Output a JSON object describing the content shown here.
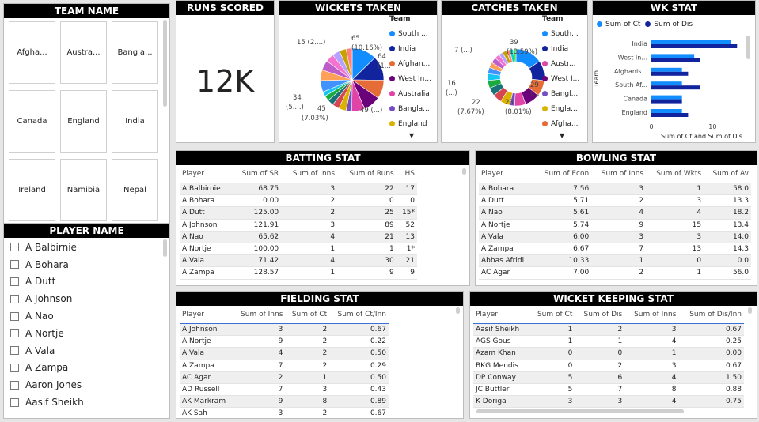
{
  "team_name": {
    "title": "TEAM NAME",
    "tiles": [
      "Afgha...",
      "Austra...",
      "Bangla...",
      "Canada",
      "England",
      "India",
      "Ireland",
      "Namibia",
      "Nepal"
    ]
  },
  "player_name": {
    "title": "PLAYER NAME",
    "players": [
      "A Balbirnie",
      "A Bohara",
      "A Dutt",
      "A Johnson",
      "A Nao",
      "A Nortje",
      "A Vala",
      "A Zampa",
      "Aaron Jones",
      "Aasif Sheikh"
    ]
  },
  "runs_scored": {
    "title": "RUNS SCORED",
    "value": "12K"
  },
  "wickets_taken": {
    "title": "WICKETS TAKEN",
    "legend_title": "Team",
    "legend": [
      {
        "label": "South ...",
        "color": "#118DFF"
      },
      {
        "label": "India",
        "color": "#12239E"
      },
      {
        "label": "Afghan...",
        "color": "#E66C37"
      },
      {
        "label": "West In...",
        "color": "#6B007B"
      },
      {
        "label": "Australia",
        "color": "#E044A7"
      },
      {
        "label": "Bangla...",
        "color": "#744EC2"
      },
      {
        "label": "England",
        "color": "#D9B300"
      }
    ],
    "labels": {
      "a": "15 (2....)",
      "b1": "65",
      "b2": "(10.16%)",
      "c1": "64",
      "c2": "(1...",
      "d1": "34",
      "d2": "(5....)",
      "e1": "45",
      "e2": "(7.03%)",
      "f": "49 (...)"
    }
  },
  "catches_taken": {
    "title": "CATCHES TAKEN",
    "legend_title": "Team",
    "legend": [
      {
        "label": "South...",
        "color": "#118DFF"
      },
      {
        "label": "India",
        "color": "#12239E"
      },
      {
        "label": "Austr...",
        "color": "#E044A7"
      },
      {
        "label": "West I...",
        "color": "#6B007B"
      },
      {
        "label": "Bangl...",
        "color": "#744EC2"
      },
      {
        "label": "Engla...",
        "color": "#D9B300"
      },
      {
        "label": "Afgha...",
        "color": "#E66C37"
      }
    ],
    "labels": {
      "a": "7 (...)",
      "b1": "39",
      "b2": "(13.59%)",
      "c1": "29",
      "c2": "(...",
      "d1": "16",
      "d2": "(...)",
      "e1": "22",
      "e2": "(7.67%)",
      "f1": "23",
      "f2": "(8.01%)"
    }
  },
  "wk_stat": {
    "title": "WK STAT",
    "legend": [
      {
        "label": "Sum of Ct",
        "color": "#118DFF"
      },
      {
        "label": "Sum of Dis",
        "color": "#12239E"
      }
    ],
    "y_title": "Team",
    "x_title": "Sum of Ct and Sum of Dis",
    "x_ticks": [
      "0",
      "10"
    ]
  },
  "chart_data": {
    "type": "bar",
    "orientation": "horizontal",
    "categories": [
      "India",
      "West In...",
      "Afghanis...",
      "South Af...",
      "Canada",
      "England"
    ],
    "series": [
      {
        "name": "Sum of Ct",
        "values": [
          13,
          7,
          5,
          5,
          5,
          5
        ]
      },
      {
        "name": "Sum of Dis",
        "values": [
          14,
          8,
          6,
          8,
          5,
          6
        ]
      }
    ],
    "xlabel": "Sum of Ct and Sum of Dis",
    "ylabel": "Team",
    "xlim": [
      0,
      15
    ]
  },
  "batting": {
    "title": "BATTING STAT",
    "columns": [
      "Player",
      "Sum of SR",
      "Sum of Inns",
      "Sum of Runs",
      "HS"
    ],
    "rows": [
      [
        "A Balbirnie",
        "68.75",
        "3",
        "22",
        "17"
      ],
      [
        "A Bohara",
        "0.00",
        "2",
        "0",
        "0"
      ],
      [
        "A Dutt",
        "125.00",
        "2",
        "25",
        "15*"
      ],
      [
        "A Johnson",
        "121.91",
        "3",
        "89",
        "52"
      ],
      [
        "A Nao",
        "65.62",
        "4",
        "21",
        "13"
      ],
      [
        "A Nortje",
        "100.00",
        "1",
        "1",
        "1*"
      ],
      [
        "A Vala",
        "71.42",
        "4",
        "30",
        "21"
      ],
      [
        "A Zampa",
        "128.57",
        "1",
        "9",
        "9"
      ]
    ]
  },
  "bowling": {
    "title": "BOWLING STAT",
    "columns": [
      "Player",
      "Sum of Econ",
      "Sum of Inns",
      "Sum of Wkts",
      "Sum of Av"
    ],
    "rows": [
      [
        "A Bohara",
        "7.56",
        "3",
        "1",
        "58.0"
      ],
      [
        "A Dutt",
        "5.71",
        "2",
        "3",
        "13.3"
      ],
      [
        "A Nao",
        "5.61",
        "4",
        "4",
        "18.2"
      ],
      [
        "A Nortje",
        "5.74",
        "9",
        "15",
        "13.4"
      ],
      [
        "A Vala",
        "6.00",
        "3",
        "3",
        "14.0"
      ],
      [
        "A Zampa",
        "6.67",
        "7",
        "13",
        "14.3"
      ],
      [
        "Abbas Afridi",
        "10.33",
        "1",
        "0",
        "0.0"
      ],
      [
        "AC Agar",
        "7.00",
        "2",
        "1",
        "56.0"
      ]
    ]
  },
  "fielding": {
    "title": "FIELDING STAT",
    "columns": [
      "Player",
      "Sum of Inns",
      "Sum of Ct",
      "Sum of Ct/Inn"
    ],
    "rows": [
      [
        "A Johnson",
        "3",
        "2",
        "0.67"
      ],
      [
        "A Nortje",
        "9",
        "2",
        "0.22"
      ],
      [
        "A Vala",
        "4",
        "2",
        "0.50"
      ],
      [
        "A Zampa",
        "7",
        "2",
        "0.29"
      ],
      [
        "AC Agar",
        "2",
        "1",
        "0.50"
      ],
      [
        "AD Russell",
        "7",
        "3",
        "0.43"
      ],
      [
        "AK Markram",
        "9",
        "8",
        "0.89"
      ],
      [
        "AK Sah",
        "3",
        "2",
        "0.67"
      ]
    ]
  },
  "wicket_keeping": {
    "title": "WICKET KEEPING STAT",
    "columns": [
      "Player",
      "Sum of Ct",
      "Sum of Dis",
      "Sum of Inns",
      "Sum of Dis/Inn"
    ],
    "rows": [
      [
        "Aasif Sheikh",
        "1",
        "2",
        "3",
        "0.67"
      ],
      [
        "AGS Gous",
        "1",
        "1",
        "4",
        "0.25"
      ],
      [
        "Azam Khan",
        "0",
        "0",
        "1",
        "0.00"
      ],
      [
        "BKG Mendis",
        "0",
        "2",
        "3",
        "0.67"
      ],
      [
        "DP Conway",
        "5",
        "6",
        "4",
        "1.50"
      ],
      [
        "JC Buttler",
        "5",
        "7",
        "8",
        "0.88"
      ],
      [
        "K Doriga",
        "3",
        "3",
        "4",
        "0.75"
      ]
    ]
  }
}
